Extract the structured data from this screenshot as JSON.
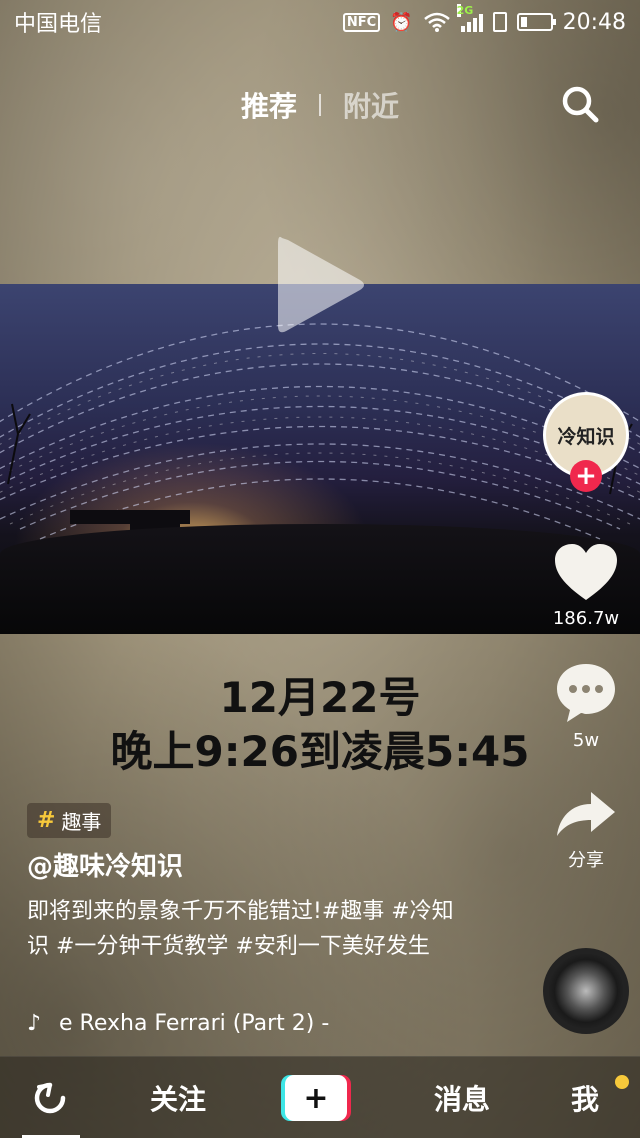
{
  "status_bar": {
    "carrier": "中国电信",
    "nfc": "NFC",
    "network": "2G",
    "time": "20:48"
  },
  "top_tabs": {
    "recommend": "推荐",
    "nearby": "附近"
  },
  "video": {
    "caption_line1": "12月22号",
    "caption_line2": "晚上9:26到凌晨5:45"
  },
  "rail": {
    "avatar_text": "冷知识",
    "likes": "186.7w",
    "comments": "5w",
    "share_label": "分享"
  },
  "info": {
    "tag": "趣事",
    "author": "@趣味冷知识",
    "description": "即将到来的景象千万不能错过!#趣事 #冷知识 #一分钟干货教学 #安利一下美好发生",
    "music": "e Rexha    Ferrari (Part 2) -"
  },
  "bottom_nav": {
    "follow": "关注",
    "add": "+",
    "messages": "消息",
    "me": "我"
  },
  "colors": {
    "accent_red": "#f0284d",
    "accent_cyan": "#3ee6e6",
    "notify_yellow": "#f7c93b"
  }
}
